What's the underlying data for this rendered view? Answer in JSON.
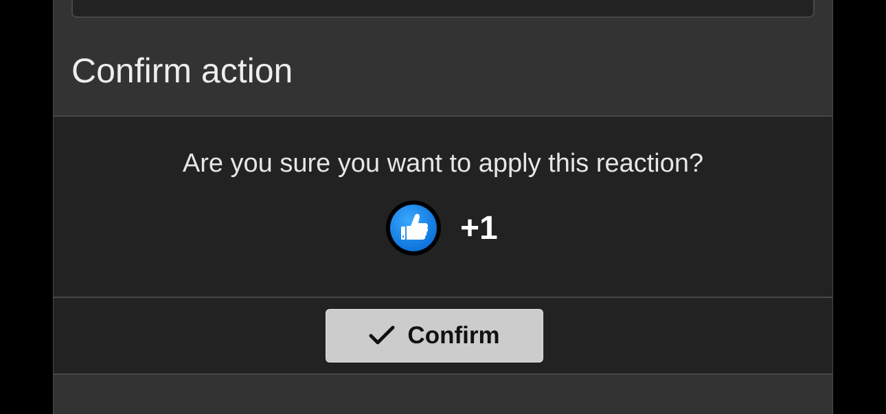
{
  "dialog": {
    "title": "Confirm action",
    "question": "Are you sure you want to apply this reaction?",
    "reaction": {
      "icon": "thumbs-up-icon",
      "label": "+1",
      "color": "#1a8cff"
    },
    "confirm_button": {
      "icon": "checkmark-icon",
      "label": "Confirm"
    }
  }
}
